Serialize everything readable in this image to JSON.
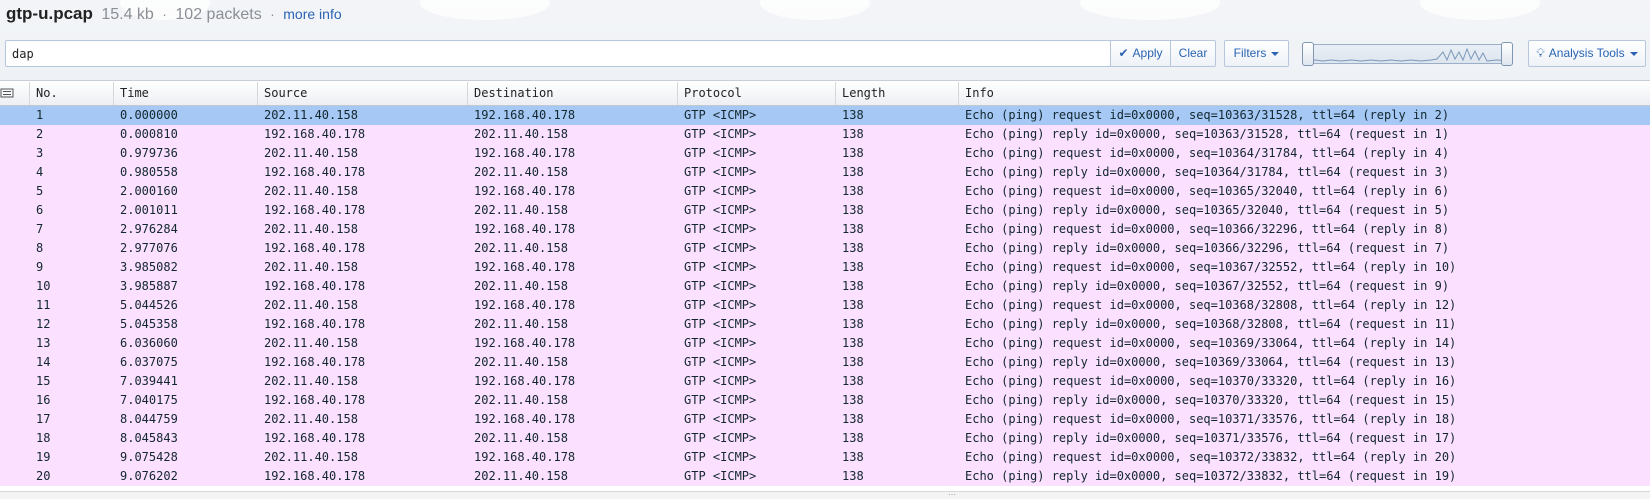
{
  "header": {
    "filename": "gtp-u.pcap",
    "size": "15.4 kb",
    "separator": "·",
    "packets": "102 packets",
    "more_info": "more info"
  },
  "filter": {
    "value": "dap"
  },
  "buttons": {
    "apply": "Apply",
    "clear": "Clear",
    "filters": "Filters",
    "analysis_tools": "Analysis Tools"
  },
  "icons": {
    "apply": "check-icon",
    "analysis_tools": "lightbulb-icon",
    "columns": "columns-menu-icon"
  },
  "colors": {
    "row_background": "#fce0ff",
    "selected_row": "#a6c8f5",
    "accent": "#2a64b3"
  },
  "table": {
    "columns": [
      "No.",
      "Time",
      "Source",
      "Destination",
      "Protocol",
      "Length",
      "Info"
    ],
    "rows": [
      {
        "no": "1",
        "time": "0.000000",
        "src": "202.11.40.158",
        "dst": "192.168.40.178",
        "proto": "GTP <ICMP>",
        "len": "138",
        "info": "Echo (ping) request id=0x0000, seq=10363/31528, ttl=64 (reply in 2)",
        "selected": true
      },
      {
        "no": "2",
        "time": "0.000810",
        "src": "192.168.40.178",
        "dst": "202.11.40.158",
        "proto": "GTP <ICMP>",
        "len": "138",
        "info": "Echo (ping) reply id=0x0000, seq=10363/31528, ttl=64 (request in 1)"
      },
      {
        "no": "3",
        "time": "0.979736",
        "src": "202.11.40.158",
        "dst": "192.168.40.178",
        "proto": "GTP <ICMP>",
        "len": "138",
        "info": "Echo (ping) request id=0x0000, seq=10364/31784, ttl=64 (reply in 4)"
      },
      {
        "no": "4",
        "time": "0.980558",
        "src": "192.168.40.178",
        "dst": "202.11.40.158",
        "proto": "GTP <ICMP>",
        "len": "138",
        "info": "Echo (ping) reply id=0x0000, seq=10364/31784, ttl=64 (request in 3)"
      },
      {
        "no": "5",
        "time": "2.000160",
        "src": "202.11.40.158",
        "dst": "192.168.40.178",
        "proto": "GTP <ICMP>",
        "len": "138",
        "info": "Echo (ping) request id=0x0000, seq=10365/32040, ttl=64 (reply in 6)"
      },
      {
        "no": "6",
        "time": "2.001011",
        "src": "192.168.40.178",
        "dst": "202.11.40.158",
        "proto": "GTP <ICMP>",
        "len": "138",
        "info": "Echo (ping) reply id=0x0000, seq=10365/32040, ttl=64 (request in 5)"
      },
      {
        "no": "7",
        "time": "2.976284",
        "src": "202.11.40.158",
        "dst": "192.168.40.178",
        "proto": "GTP <ICMP>",
        "len": "138",
        "info": "Echo (ping) request id=0x0000, seq=10366/32296, ttl=64 (reply in 8)"
      },
      {
        "no": "8",
        "time": "2.977076",
        "src": "192.168.40.178",
        "dst": "202.11.40.158",
        "proto": "GTP <ICMP>",
        "len": "138",
        "info": "Echo (ping) reply id=0x0000, seq=10366/32296, ttl=64 (request in 7)"
      },
      {
        "no": "9",
        "time": "3.985082",
        "src": "202.11.40.158",
        "dst": "192.168.40.178",
        "proto": "GTP <ICMP>",
        "len": "138",
        "info": "Echo (ping) request id=0x0000, seq=10367/32552, ttl=64 (reply in 10)"
      },
      {
        "no": "10",
        "time": "3.985887",
        "src": "192.168.40.178",
        "dst": "202.11.40.158",
        "proto": "GTP <ICMP>",
        "len": "138",
        "info": "Echo (ping) reply id=0x0000, seq=10367/32552, ttl=64 (request in 9)"
      },
      {
        "no": "11",
        "time": "5.044526",
        "src": "202.11.40.158",
        "dst": "192.168.40.178",
        "proto": "GTP <ICMP>",
        "len": "138",
        "info": "Echo (ping) request id=0x0000, seq=10368/32808, ttl=64 (reply in 12)"
      },
      {
        "no": "12",
        "time": "5.045358",
        "src": "192.168.40.178",
        "dst": "202.11.40.158",
        "proto": "GTP <ICMP>",
        "len": "138",
        "info": "Echo (ping) reply id=0x0000, seq=10368/32808, ttl=64 (request in 11)"
      },
      {
        "no": "13",
        "time": "6.036060",
        "src": "202.11.40.158",
        "dst": "192.168.40.178",
        "proto": "GTP <ICMP>",
        "len": "138",
        "info": "Echo (ping) request id=0x0000, seq=10369/33064, ttl=64 (reply in 14)"
      },
      {
        "no": "14",
        "time": "6.037075",
        "src": "192.168.40.178",
        "dst": "202.11.40.158",
        "proto": "GTP <ICMP>",
        "len": "138",
        "info": "Echo (ping) reply id=0x0000, seq=10369/33064, ttl=64 (request in 13)"
      },
      {
        "no": "15",
        "time": "7.039441",
        "src": "202.11.40.158",
        "dst": "192.168.40.178",
        "proto": "GTP <ICMP>",
        "len": "138",
        "info": "Echo (ping) request id=0x0000, seq=10370/33320, ttl=64 (reply in 16)"
      },
      {
        "no": "16",
        "time": "7.040175",
        "src": "192.168.40.178",
        "dst": "202.11.40.158",
        "proto": "GTP <ICMP>",
        "len": "138",
        "info": "Echo (ping) reply id=0x0000, seq=10370/33320, ttl=64 (request in 15)"
      },
      {
        "no": "17",
        "time": "8.044759",
        "src": "202.11.40.158",
        "dst": "192.168.40.178",
        "proto": "GTP <ICMP>",
        "len": "138",
        "info": "Echo (ping) request id=0x0000, seq=10371/33576, ttl=64 (reply in 18)"
      },
      {
        "no": "18",
        "time": "8.045843",
        "src": "192.168.40.178",
        "dst": "202.11.40.158",
        "proto": "GTP <ICMP>",
        "len": "138",
        "info": "Echo (ping) reply id=0x0000, seq=10371/33576, ttl=64 (request in 17)"
      },
      {
        "no": "19",
        "time": "9.075428",
        "src": "202.11.40.158",
        "dst": "192.168.40.178",
        "proto": "GTP <ICMP>",
        "len": "138",
        "info": "Echo (ping) request id=0x0000, seq=10372/33832, ttl=64 (reply in 20)"
      },
      {
        "no": "20",
        "time": "9.076202",
        "src": "192.168.40.178",
        "dst": "202.11.40.158",
        "proto": "GTP <ICMP>",
        "len": "138",
        "info": "Echo (ping) reply id=0x0000, seq=10372/33832, ttl=64 (request in 19)"
      }
    ]
  }
}
